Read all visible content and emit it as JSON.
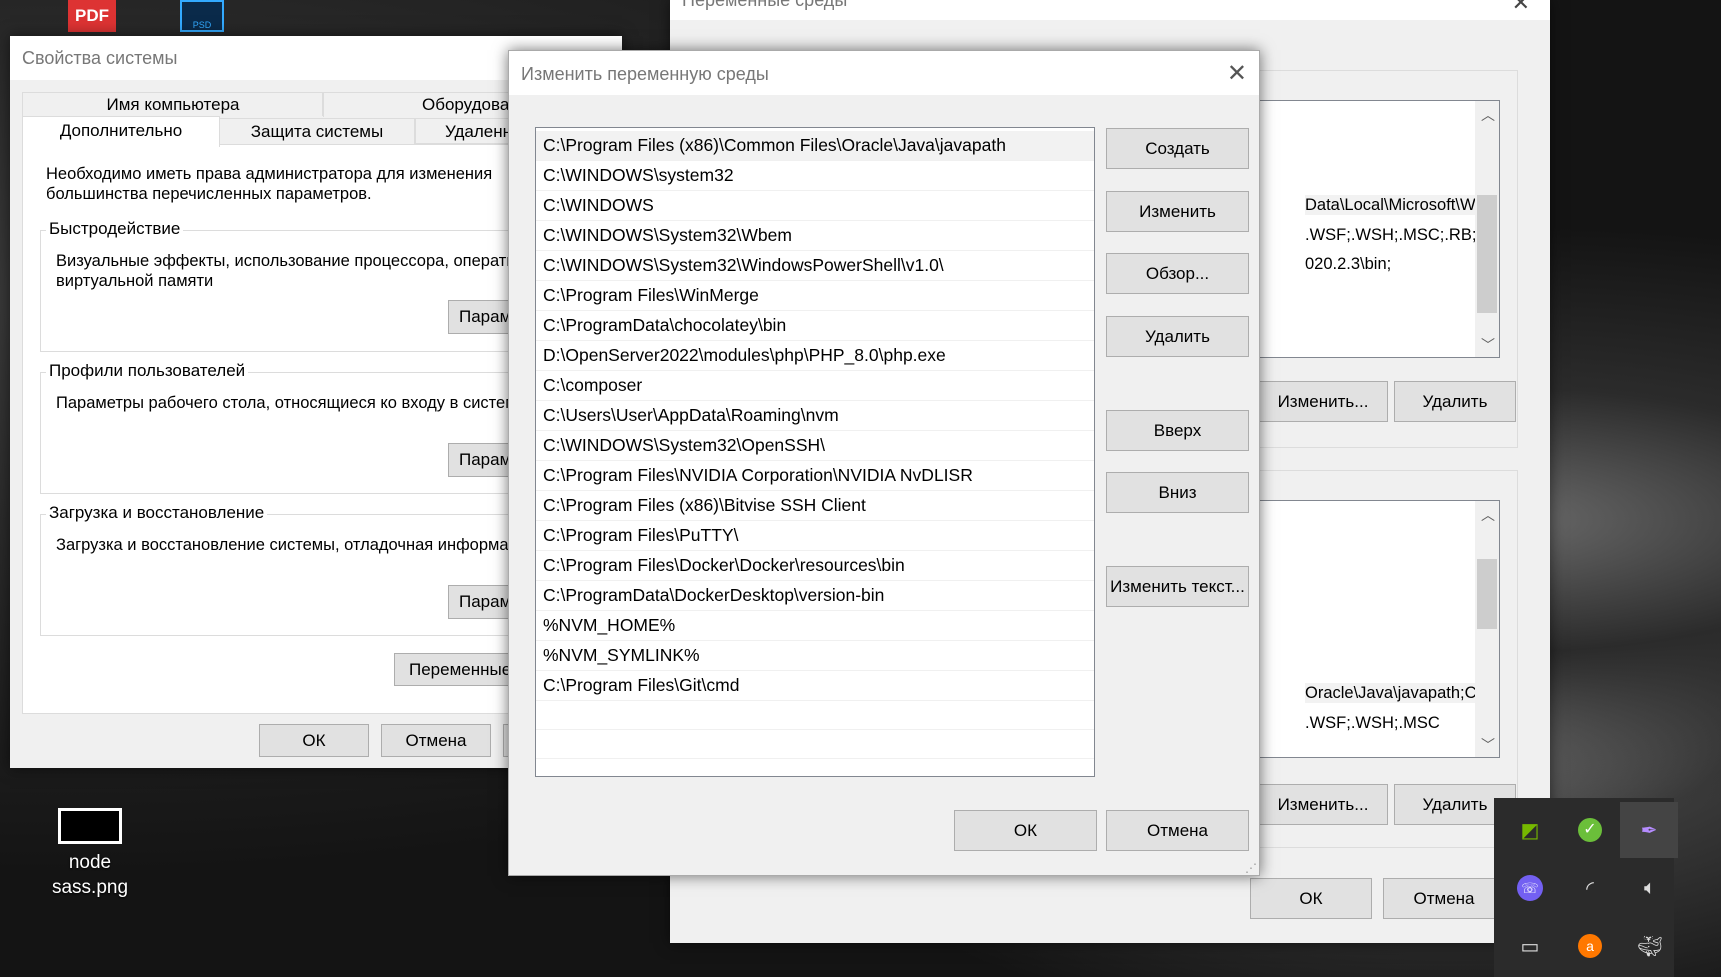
{
  "desktop": {
    "icons": [
      {
        "label_line1": "node",
        "label_line2": "sass.png"
      }
    ],
    "pdf_icon_text": "PDF",
    "psd_icon_text": "PSD"
  },
  "system_properties": {
    "title": "Свойства системы",
    "tabs_row1": [
      "Имя компьютера",
      "Оборудовани"
    ],
    "tabs_row2": [
      "Дополнительно",
      "Защита системы",
      "Удаленны"
    ],
    "admin_note": "Необходимо иметь права администратора для изменения большинства перечисленных параметров.",
    "admin_note_line1": "Необходимо иметь права администратора для изменения",
    "admin_note_line2": "большинства перечисленных параметров.",
    "performance": {
      "legend": "Быстродействие",
      "line1": "Визуальные эффекты, использование процессора, операти",
      "line2": "виртуальной памяти",
      "button": "Парам"
    },
    "profiles": {
      "legend": "Профили пользователей",
      "line1": "Параметры рабочего стола, относящиеся ко входу в систем",
      "button": "Парам"
    },
    "startup": {
      "legend": "Загрузка и восстановление",
      "line1": "Загрузка и восстановление системы, отладочная информа",
      "button": "Парам"
    },
    "env_button": "Переменные",
    "ok": "ОК",
    "cancel": "Отмена"
  },
  "env_vars": {
    "title": "Переменные среды",
    "user_values": [
      "Data\\Local\\Microsoft\\Win...",
      ".WSF;.WSH;.MSC;.RB;.RBW...",
      "020.2.3\\bin;"
    ],
    "system_values": [
      "Oracle\\Java\\javapath;C:\\WI...",
      ".WSF;.WSH;.MSC"
    ],
    "edit_button": "Изменить...",
    "delete_button": "Удалить",
    "ok": "ОК",
    "cancel": "Отмена"
  },
  "edit_dialog": {
    "title": "Изменить переменную среды",
    "paths": [
      "C:\\Program Files (x86)\\Common Files\\Oracle\\Java\\javapath",
      "C:\\WINDOWS\\system32",
      "C:\\WINDOWS",
      "C:\\WINDOWS\\System32\\Wbem",
      "C:\\WINDOWS\\System32\\WindowsPowerShell\\v1.0\\",
      "C:\\Program Files\\WinMerge",
      "C:\\ProgramData\\chocolatey\\bin",
      "D:\\OpenServer2022\\modules\\php\\PHP_8.0\\php.exe",
      "C:\\composer",
      "C:\\Users\\User\\AppData\\Roaming\\nvm",
      "C:\\WINDOWS\\System32\\OpenSSH\\",
      "C:\\Program Files\\NVIDIA Corporation\\NVIDIA NvDLISR",
      "C:\\Program Files (x86)\\Bitvise SSH Client",
      "C:\\Program Files\\PuTTY\\",
      "C:\\Program Files\\Docker\\Docker\\resources\\bin",
      "C:\\ProgramData\\DockerDesktop\\version-bin",
      "%NVM_HOME%",
      "%NVM_SYMLINK%",
      "C:\\Program Files\\Git\\cmd"
    ],
    "buttons": {
      "create": "Создать",
      "edit": "Изменить",
      "browse": "Обзор...",
      "delete": "Удалить",
      "up": "Вверх",
      "down": "Вниз",
      "edit_text": "Изменить текст...",
      "ok": "ОК",
      "cancel": "Отмена"
    }
  },
  "tray": {
    "icons": [
      "nvidia-icon",
      "shield-check-icon",
      "feather-icon",
      "viber-icon",
      "wifi-icon",
      "speaker-icon",
      "battery-icon",
      "avast-icon",
      "docker-icon"
    ]
  }
}
